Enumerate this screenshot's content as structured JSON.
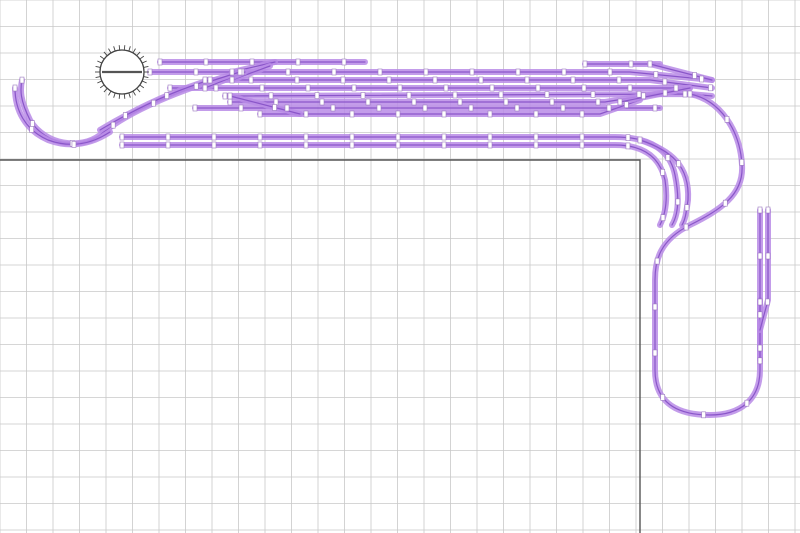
{
  "diagram": {
    "type": "model-railway-track-plan",
    "grid": true,
    "colors": {
      "background": "#ffffff",
      "grid": "#c8c8c8",
      "baseboard_outline": "#555555",
      "track": "#b98be6",
      "rail": "#8a56c9",
      "joiner": "#ffffff",
      "turntable_outline": "#444444"
    },
    "elements": {
      "turntable": "turntable-icon",
      "joiners": "track-joiner-markers"
    }
  }
}
